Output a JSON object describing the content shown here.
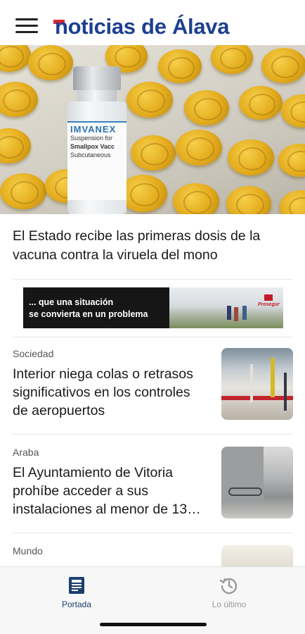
{
  "header": {
    "menu_icon": "hamburger-menu-icon",
    "logo_text": "noticias de Álava",
    "brand_color": "#1d3f92",
    "accent_color": "#d6262d"
  },
  "hero": {
    "headline": "El Estado recibe las primeras dosis de la vacuna contra la viruela del mono",
    "vial_label": {
      "brand": "IMVANEX",
      "line1": "Suspension for",
      "line2": "Smallpox Vacc",
      "line3": "Subcutaneous"
    }
  },
  "ad": {
    "text_line1": "... que una situación",
    "text_line2": "se convierta en un problema",
    "logo_text": "Prosegur"
  },
  "articles": [
    {
      "section": "Sociedad",
      "title": "Interior niega colas o retrasos significativos en los controles de aeropuertos"
    },
    {
      "section": "Araba",
      "title": "El Ayuntamiento de Vitoria prohíbe acceder a sus instalaciones al menor de 13…"
    },
    {
      "section": "Mundo",
      "title": ""
    }
  ],
  "tabbar": {
    "tabs": [
      {
        "label": "Portada",
        "icon": "newspaper-icon",
        "active": true
      },
      {
        "label": "Lo último",
        "icon": "history-clock-icon",
        "active": false
      }
    ],
    "active_color": "#1d3f6e",
    "inactive_color": "#9a9a9a"
  }
}
